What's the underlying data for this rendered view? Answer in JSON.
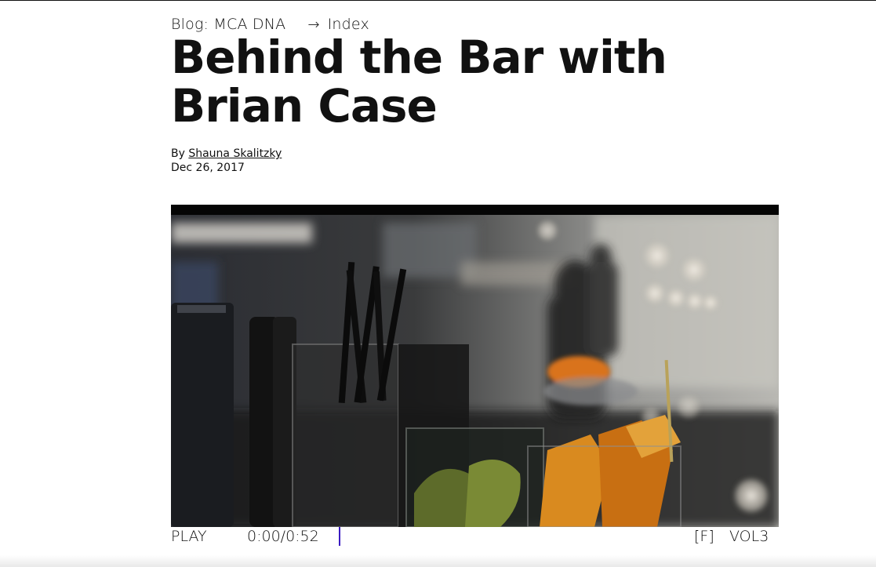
{
  "breadcrumb": {
    "section": "Blog: MCA DNA",
    "arrow": "→",
    "index": "Index"
  },
  "article": {
    "title": "Behind the Bar with Brian Case",
    "byline_prefix": "By",
    "author": "Shauna Skalitzky",
    "date": "Dec 26, 2017"
  },
  "video": {
    "icon": "bar-scene-image",
    "controls": {
      "play_label": "PLAY",
      "time": "0:00/0:52",
      "fullscreen_label": "[F]",
      "volume_label": "VOL3",
      "progress": 0
    }
  },
  "colors": {
    "text": "#111111",
    "accent": "#3b1cc2",
    "background": "#ffffff"
  }
}
